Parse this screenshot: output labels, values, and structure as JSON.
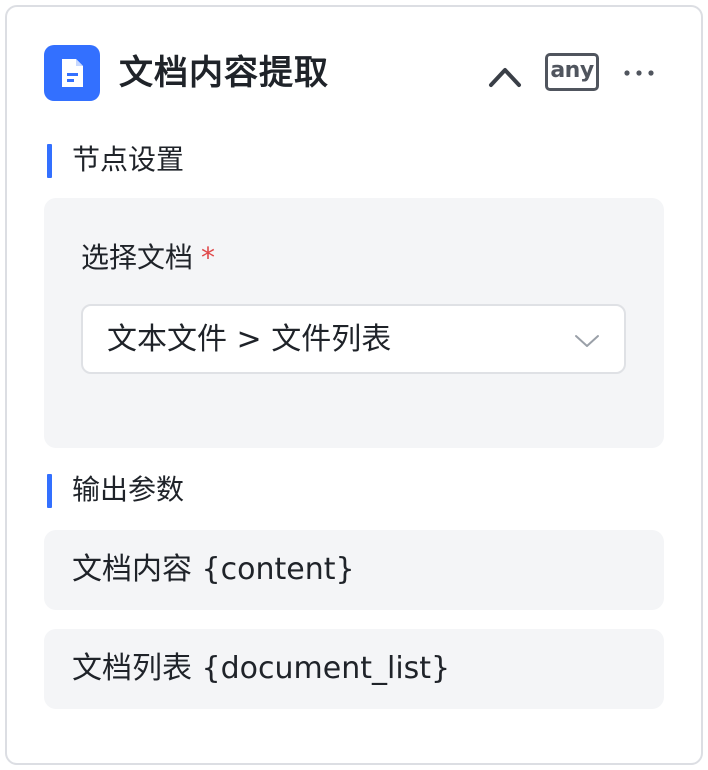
{
  "header": {
    "icon": "document-icon",
    "icon_color": "#3370ff",
    "title": "文档内容提取",
    "collapse_icon": "chevron-up-icon",
    "type_badge": "any",
    "more_icon": "ellipsis-icon"
  },
  "node_settings": {
    "section_title": "节点设置",
    "field_label": "选择文档",
    "required_mark": "*",
    "select_value": "文本文件 > 文件列表",
    "select_icon": "chevron-down-icon"
  },
  "output_params": {
    "section_title": "输出参数",
    "items": [
      {
        "label": "文档内容 {content}"
      },
      {
        "label": "文档列表 {document_list}"
      }
    ]
  },
  "colors": {
    "accent": "#3370ff",
    "required": "#e0494a",
    "panel_bg": "#f4f5f7"
  }
}
